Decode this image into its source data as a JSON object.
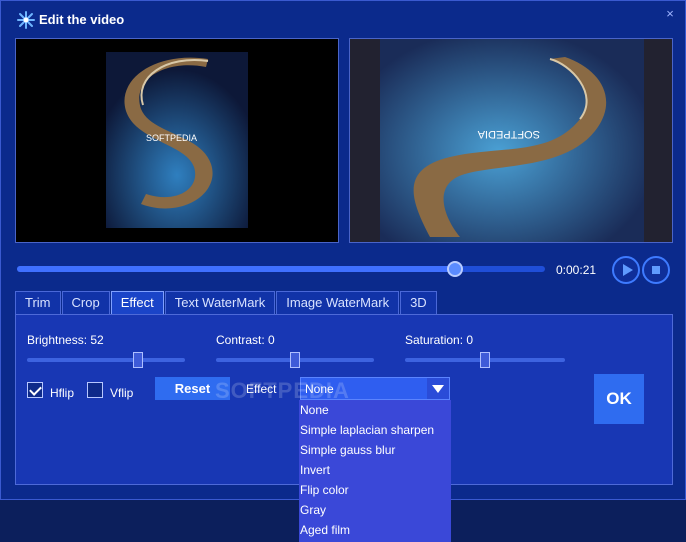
{
  "window": {
    "title": "Edit the video",
    "close": "×"
  },
  "player": {
    "time": "0:00:21",
    "progress": 0.83
  },
  "tabs": [
    "Trim",
    "Crop",
    "Effect",
    "Text WaterMark",
    "Image WaterMark",
    "3D"
  ],
  "active_tab": "Effect",
  "effect_panel": {
    "brightness_label": "Brightness: 52",
    "contrast_label": "Contrast: 0",
    "saturation_label": "Saturation: 0",
    "brightness_level": 0.7,
    "contrast_level": 0.5,
    "saturation_level": 0.5,
    "hflip_label": "Hflip",
    "hflip_checked": true,
    "vflip_label": "Vflip",
    "vflip_checked": false,
    "reset_label": "Reset",
    "effect_label": "Effect",
    "effect_value": "None",
    "effect_options": [
      "None",
      "Simple laplacian sharpen",
      "Simple gauss blur",
      "Invert",
      "Flip color",
      "Gray",
      "Aged film"
    ],
    "ok_label": "OK"
  },
  "watermark_text": "SOFTPEDIA",
  "colors": {
    "window_bg": "#0b2a8c",
    "panel_bg": "#1837b4",
    "accent": "#2f6cf0",
    "dropdown_bg": "#3a48d8"
  }
}
